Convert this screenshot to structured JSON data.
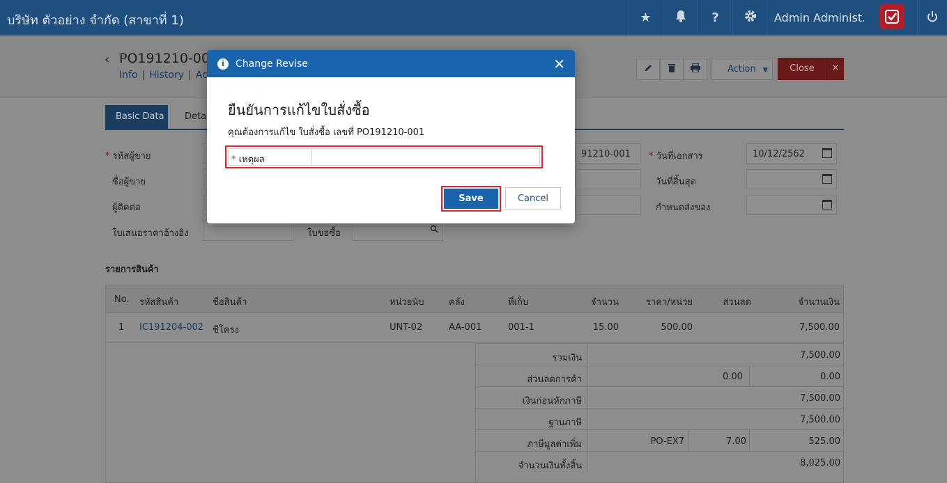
{
  "topbar": {
    "company": "บริษัท ตัวอย่าง จำกัด (สาขาที่ 1)",
    "user": "Admin Administ..."
  },
  "document": {
    "number": "PO191210-001",
    "links": [
      "Info",
      "History",
      "Ac"
    ]
  },
  "toolbar": {
    "action_label": "Action",
    "close_label": "Close",
    "close_x": "×"
  },
  "tabs": {
    "basic": "Basic Data",
    "detail": "Detail"
  },
  "form": {
    "vendor_code": "รหัสผู้ขาย",
    "vendor_name": "ชื่อผู้ขาย",
    "contact": "ผู้ติดต่อ",
    "quotation_ref": "ใบเสนอราคาอ้างอิง",
    "purchase_request": "ใบขอซื้อ",
    "doc_number_visible": "91210-001",
    "doc_date_label": "วันที่เอกสาร",
    "doc_date_value": "10/12/2562",
    "end_date_label": "วันที่สิ้นสุด",
    "delivery_label": "กำหนดส่งของ"
  },
  "items": {
    "section_title": "รายการสินค้า",
    "headers": [
      "No.",
      "รหัสสินค้า",
      "ชื่อสินค้า",
      "หน่วยนับ",
      "คลัง",
      "ที่เก็บ",
      "จำนวน",
      "ราคา/หน่วย",
      "ส่วนลด",
      "จำนวนเงิน"
    ],
    "rows": [
      {
        "no": "1",
        "code": "IC191204-002",
        "name": "ชีโครง",
        "unit": "UNT-02",
        "warehouse": "AA-001",
        "location": "001-1",
        "qty": "15.00",
        "price": "500.00",
        "discount": "",
        "amount": "7,500.00"
      }
    ]
  },
  "summary": {
    "total_label": "รวมเงิน",
    "total": "7,500.00",
    "discount_label": "ส่วนลดการค้า",
    "discount_pct": "0.00",
    "discount": "0.00",
    "before_tax_label": "เงินก่อนหักภาษี",
    "before_tax": "7,500.00",
    "tax_base_label": "ฐานภาษี",
    "tax_base": "7,500.00",
    "vat_label": "ภาษีมูลค่าเพิ่ม",
    "vat_code": "PO-EX7",
    "vat_rate": "7.00",
    "vat": "525.00",
    "grand_label": "จำนวนเงินทั้งสิ้น",
    "grand": "8,025.00"
  },
  "modal": {
    "title": "Change Revise",
    "heading": "ยืนยันการแก้ไขใบสั่งซื้อ",
    "message": "คุณต้องการแก้ไข ใบสั่งซื้อ เลขที่ PO191210-001",
    "reason_label": "เหตุผล",
    "reason_value": "",
    "save_label": "Save",
    "cancel_label": "Cancel"
  }
}
